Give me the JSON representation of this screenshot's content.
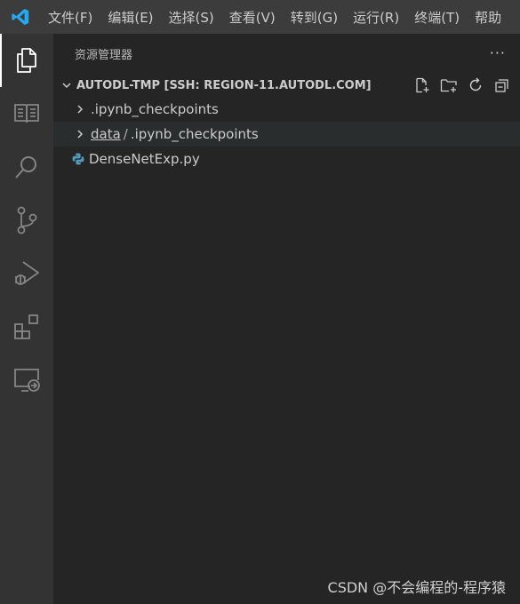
{
  "menubar": {
    "items": [
      "文件(F)",
      "编辑(E)",
      "选择(S)",
      "查看(V)",
      "转到(G)",
      "运行(R)",
      "终端(T)",
      "帮助"
    ]
  },
  "activity_bar": {
    "icons": [
      "explorer-icon",
      "book-icon",
      "search-icon",
      "source-control-icon",
      "run-debug-icon",
      "extensions-icon",
      "remote-explorer-icon"
    ],
    "active": "explorer-icon"
  },
  "sidebar": {
    "title": "资源管理器",
    "more_actions": "···",
    "folder": {
      "name": "AUTODL-TMP [SSH: REGION-11.AUTODL.COM]",
      "actions": [
        "new-file-icon",
        "new-folder-icon",
        "refresh-icon",
        "collapse-all-icon"
      ]
    },
    "tree": [
      {
        "type": "folder",
        "label": ".ipynb_checkpoints"
      },
      {
        "type": "folder",
        "parts": [
          "data",
          "/",
          ".ipynb_checkpoints"
        ]
      },
      {
        "type": "file",
        "label": "DenseNetExp.py",
        "icon": "python-icon"
      }
    ]
  },
  "colors": {
    "accent": "#007acc",
    "python_icon": "#519aba"
  },
  "watermark": "CSDN @不会编程的-程序猿"
}
